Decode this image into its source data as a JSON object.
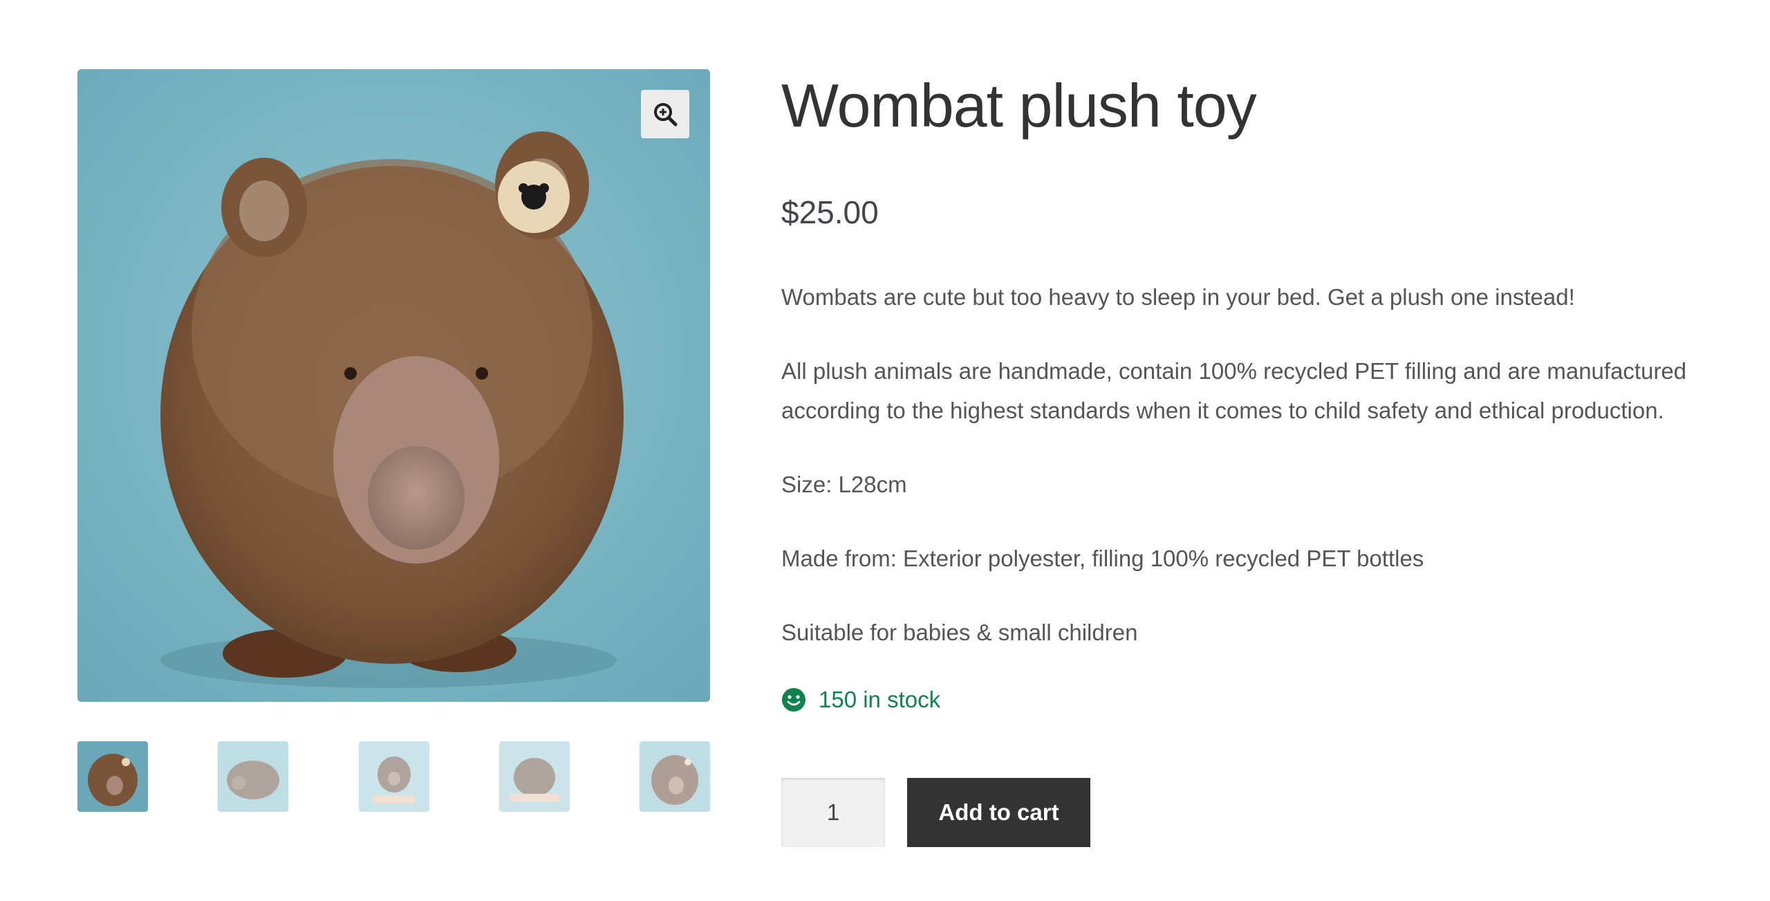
{
  "product": {
    "title": "Wombat plush toy",
    "price": "$25.00",
    "description": [
      "Wombats are cute but too heavy to sleep in your bed. Get a plush one instead!",
      "All plush animals are handmade, contain 100% recycled PET filling and are manufactured according to the highest standards when it comes to child safety and ethical production.",
      "Size: L28cm",
      "Made from: Exterior polyester, filling 100% recycled PET bottles",
      "Suitable for babies & small children"
    ],
    "stock": "150 in stock",
    "quantity": "1",
    "add_to_cart_label": "Add to cart"
  },
  "gallery": {
    "zoom_icon": "zoom-in-icon",
    "thumbnail_count": 5,
    "active_thumbnail": 1
  },
  "colors": {
    "stock_green": "#0f834d",
    "button_bg": "#333333",
    "image_bg": "#7db3c1"
  }
}
